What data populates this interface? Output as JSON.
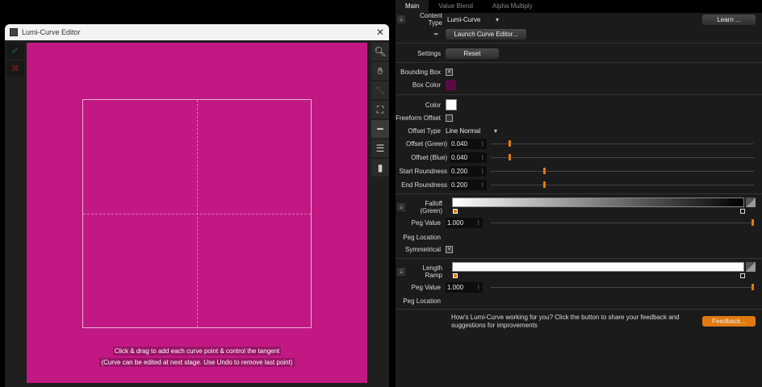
{
  "editor": {
    "title": "Lumi-Curve Editor",
    "hint_line1": "Click & drag to add each curve point & control the tangent",
    "hint_line2": "(Curve can be edited at next stage. Use Undo to remove last point)",
    "canvas_color": "#c21884"
  },
  "panel": {
    "tabs": [
      {
        "label": "Main",
        "active": true
      },
      {
        "label": "Value Blend"
      },
      {
        "label": "Alpha Multiply"
      }
    ],
    "content_type": {
      "label": "Content Type",
      "value": "Lumi-Curve"
    },
    "learn_label": "Learn ...",
    "launch_label": "Launch Curve Editor...",
    "settings": {
      "label": "Settings",
      "reset_label": "Reset"
    },
    "bounding_box": {
      "label": "Bounding Box",
      "checked": true
    },
    "box_color": {
      "label": "Box Color",
      "value": "#5a0a45"
    },
    "color": {
      "label": "Color",
      "value": "#ffffff"
    },
    "freeform_offset": {
      "label": "Freeform Offset",
      "checked": false
    },
    "offset_type": {
      "label": "Offset Type",
      "value": "Line Normal"
    },
    "sliders": [
      {
        "label": "Offset (Green)",
        "value": "0.040",
        "position": 0.067
      },
      {
        "label": "Offset (Blue)",
        "value": "0.040",
        "position": 0.067
      },
      {
        "label": "Start Roundness",
        "value": "0.200",
        "position": 0.2
      },
      {
        "label": "End Roundness",
        "value": "0.200",
        "position": 0.2
      }
    ],
    "falloff": {
      "label": "Falloff (Green)",
      "peg_value_label": "Peg Value",
      "peg_value": "1.000",
      "peg_location_label": "Peg Location",
      "symmetrical_label": "Symmetrical",
      "symmetrical": true
    },
    "length_ramp": {
      "label": "Length Ramp",
      "peg_value_label": "Peg Value",
      "peg_value": "1.000",
      "peg_location_label": "Peg Location"
    },
    "feedback": {
      "text": "How's Lumi-Curve working for you? Click the button to share your feedback and suggestions for improvements",
      "button": "Feedback...",
      "accent": "#e07a10"
    }
  }
}
